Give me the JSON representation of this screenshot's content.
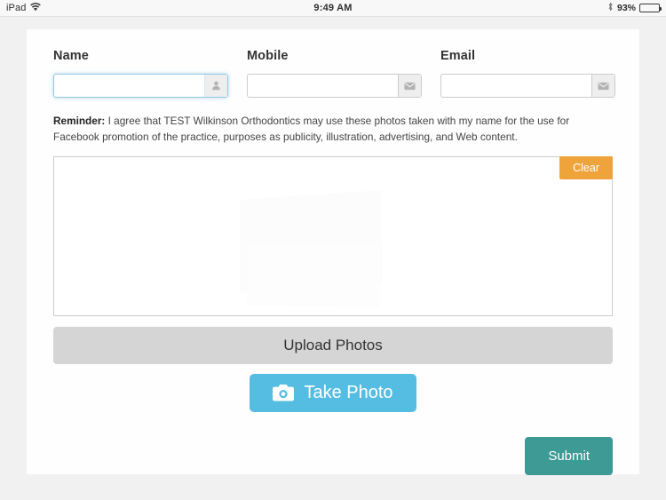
{
  "status_bar": {
    "device_label": "iPad",
    "wifi_icon": "wifi-icon",
    "time": "9:49 AM",
    "bluetooth_icon": "bluetooth-icon",
    "battery_percent": "93%",
    "battery_level": 93
  },
  "form": {
    "fields": [
      {
        "label": "Name",
        "value": "",
        "placeholder": "",
        "icon": "user-icon",
        "focused": true
      },
      {
        "label": "Mobile",
        "value": "",
        "placeholder": "",
        "icon": "envelope-icon",
        "focused": false
      },
      {
        "label": "Email",
        "value": "",
        "placeholder": "",
        "icon": "envelope-icon",
        "focused": false
      }
    ],
    "reminder": {
      "prefix": "Reminder:",
      "text": " I agree that TEST Wilkinson Orthodontics may use these photos taken with my name for the use for Facebook promotion of the practice, purposes as publicity, illustration, advertising, and Web content."
    },
    "signature": {
      "clear_label": "Clear",
      "content": ""
    },
    "upload_label": "Upload Photos",
    "take_photo_label": "Take Photo",
    "take_photo_icon": "camera-icon",
    "submit_label": "Submit"
  },
  "colors": {
    "clear_orange": "#efa33b",
    "take_photo_blue": "#56bde2",
    "submit_teal": "#3e9a94",
    "upload_gray": "#d5d5d5",
    "focus_blue": "#93c9e6",
    "page_bg": "#f1f1f1"
  }
}
